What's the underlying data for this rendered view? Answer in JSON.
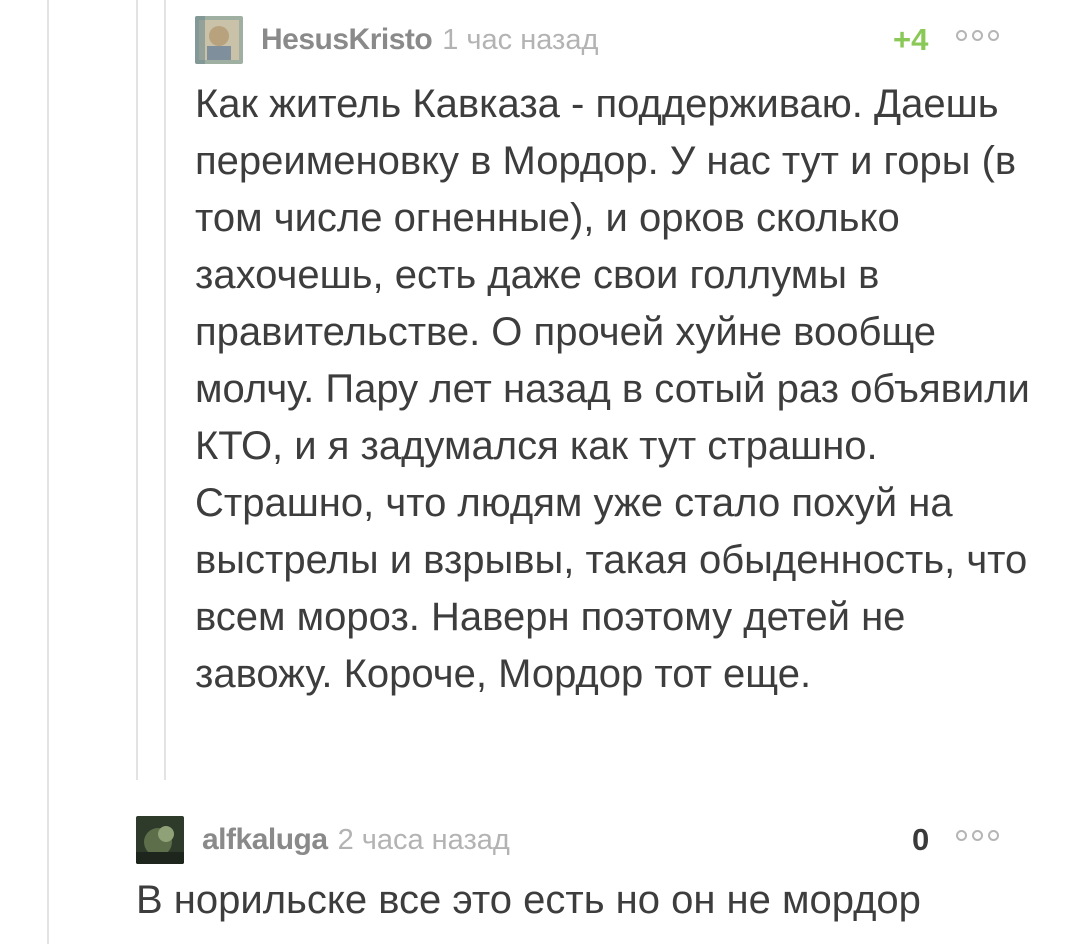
{
  "comments": [
    {
      "username": "HesusKristo",
      "time": "1 час назад",
      "rating": "+4",
      "avatar_icon": "user-avatar-icon",
      "text": "Как житель Кавказа - поддерживаю. Даешь переименовку в Мордор. У нас тут и горы (в том числе огненные), и орков сколько захочешь, есть даже свои голлумы в правительстве. О прочей хуйне вообще молчу. Пару лет назад в сотый раз объявили КТО, и я задумался как тут страшно. Страшно, что людям уже стало похуй на выстрелы и взрывы, такая обыденность, что всем мороз. Наверн поэтому детей не завожу. Короче, Мордор тот еще."
    },
    {
      "username": "alfkaluga",
      "time": "2 часа назад",
      "rating": "0",
      "avatar_icon": "user-avatar-icon",
      "text": "В норильске все это есть но он не мордор"
    }
  ],
  "colors": {
    "rating_positive": "#8ac858",
    "username": "#8a8a8a",
    "timestamp": "#b3b3b3",
    "thread_line": "#e3e3e3"
  }
}
